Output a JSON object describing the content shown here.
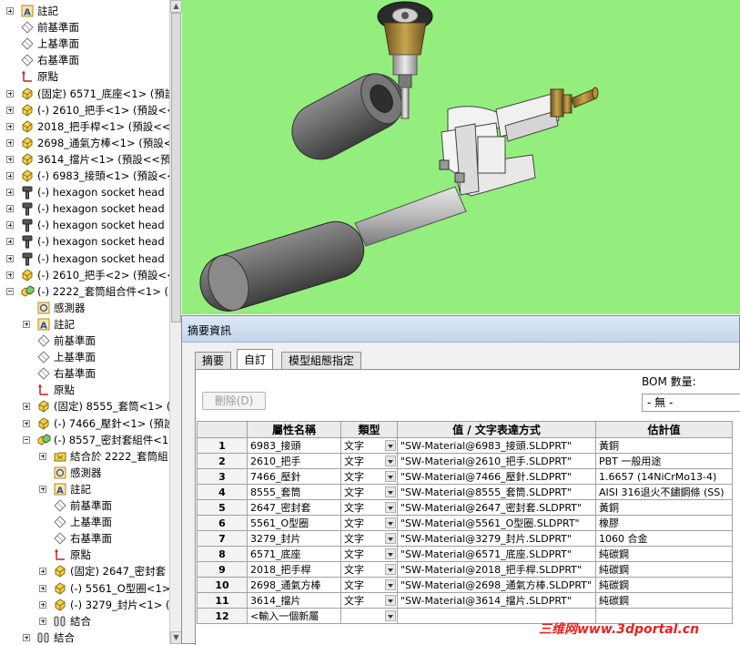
{
  "tree": {
    "nodes": [
      {
        "label": "註記",
        "icon": "annotation-icon",
        "level": 0,
        "exp": "plus"
      },
      {
        "label": "前基準面",
        "icon": "plane-icon",
        "level": 0,
        "exp": ""
      },
      {
        "label": "上基準面",
        "icon": "plane-icon",
        "level": 0,
        "exp": ""
      },
      {
        "label": "右基準面",
        "icon": "plane-icon",
        "level": 0,
        "exp": ""
      },
      {
        "label": "原點",
        "icon": "origin-icon",
        "level": 0,
        "exp": ""
      },
      {
        "label": "(固定) 6571_底座<1> (預設",
        "icon": "part-icon",
        "level": 0,
        "exp": "plus"
      },
      {
        "label": "(-) 2610_把手<1> (預設<<",
        "icon": "part-icon",
        "level": 0,
        "exp": "plus"
      },
      {
        "label": "2018_把手桿<1> (預設<<",
        "icon": "part-icon",
        "level": 0,
        "exp": "plus"
      },
      {
        "label": "2698_通氣方棒<1> (預設<",
        "icon": "part-icon",
        "level": 0,
        "exp": "plus"
      },
      {
        "label": "3614_擋片<1> (預設<<預",
        "icon": "part-icon",
        "level": 0,
        "exp": "plus"
      },
      {
        "label": "(-) 6983_接頭<1> (預設<<",
        "icon": "part-icon",
        "level": 0,
        "exp": "plus"
      },
      {
        "label": "(-) hexagon socket head",
        "icon": "screw-icon",
        "level": 0,
        "exp": "plus"
      },
      {
        "label": "(-) hexagon socket head",
        "icon": "screw-icon",
        "level": 0,
        "exp": "plus"
      },
      {
        "label": "(-) hexagon socket head",
        "icon": "screw-icon",
        "level": 0,
        "exp": "plus"
      },
      {
        "label": "(-) hexagon socket head",
        "icon": "screw-icon",
        "level": 0,
        "exp": "plus"
      },
      {
        "label": "(-) hexagon socket head",
        "icon": "screw-icon",
        "level": 0,
        "exp": "plus"
      },
      {
        "label": "(-) 2610_把手<2> (預設<<",
        "icon": "part-icon",
        "level": 0,
        "exp": "plus"
      },
      {
        "label": "(-) 2222_套筒組合件<1> (",
        "icon": "assembly-icon",
        "level": 0,
        "exp": "minus"
      },
      {
        "label": "感測器",
        "icon": "sensor-icon",
        "level": 1,
        "exp": ""
      },
      {
        "label": "註記",
        "icon": "annotation-icon",
        "level": 1,
        "exp": "plus"
      },
      {
        "label": "前基準面",
        "icon": "plane-icon",
        "level": 1,
        "exp": ""
      },
      {
        "label": "上基準面",
        "icon": "plane-icon",
        "level": 1,
        "exp": ""
      },
      {
        "label": "右基準面",
        "icon": "plane-icon",
        "level": 1,
        "exp": ""
      },
      {
        "label": "原點",
        "icon": "origin-icon",
        "level": 1,
        "exp": ""
      },
      {
        "label": "(固定) 8555_套筒<1> (",
        "icon": "part-icon",
        "level": 1,
        "exp": "plus"
      },
      {
        "label": "(-) 7466_壓針<1> (預設",
        "icon": "part-icon",
        "level": 1,
        "exp": "plus"
      },
      {
        "label": "(-) 8557_密封套組件<1",
        "icon": "assembly-icon",
        "level": 1,
        "exp": "minus"
      },
      {
        "label": "結合於 2222_套筒組",
        "icon": "mate-folder-icon",
        "level": 2,
        "exp": "plus"
      },
      {
        "label": "感測器",
        "icon": "sensor-icon",
        "level": 2,
        "exp": ""
      },
      {
        "label": "註記",
        "icon": "annotation-icon",
        "level": 2,
        "exp": "plus"
      },
      {
        "label": "前基準面",
        "icon": "plane-icon",
        "level": 2,
        "exp": ""
      },
      {
        "label": "上基準面",
        "icon": "plane-icon",
        "level": 2,
        "exp": ""
      },
      {
        "label": "右基準面",
        "icon": "plane-icon",
        "level": 2,
        "exp": ""
      },
      {
        "label": "原點",
        "icon": "origin-icon",
        "level": 2,
        "exp": ""
      },
      {
        "label": "(固定) 2647_密封套",
        "icon": "part-icon",
        "level": 2,
        "exp": "plus"
      },
      {
        "label": "(-) 5561_O型圈<1>",
        "icon": "part-icon",
        "level": 2,
        "exp": "plus"
      },
      {
        "label": "(-) 3279_封片<1> (",
        "icon": "part-icon",
        "level": 2,
        "exp": "plus"
      },
      {
        "label": "結合",
        "icon": "mates-icon",
        "level": 2,
        "exp": "plus"
      },
      {
        "label": "結合",
        "icon": "mates-icon",
        "level": 1,
        "exp": "plus"
      },
      {
        "label": "結合",
        "icon": "mates-icon",
        "level": 0,
        "exp": "plus"
      }
    ]
  },
  "dialog": {
    "title": "摘要資訊",
    "tabs": [
      {
        "label": "摘要",
        "active": false
      },
      {
        "label": "自訂",
        "active": true
      },
      {
        "label": "模型組態指定",
        "active": false
      }
    ],
    "delete_label": "刪除(D)",
    "bom_label": "BOM 數量:",
    "bom_value": "- 無 -",
    "headers": [
      "",
      "屬性名稱",
      "類型",
      "值 / 文字表達方式",
      "估計值"
    ],
    "rows": [
      {
        "n": "1",
        "name": "6983_接頭",
        "type": "文字",
        "expr": "\"SW-Material@6983_接頭.SLDPRT\"",
        "val": "黃銅"
      },
      {
        "n": "2",
        "name": "2610_把手",
        "type": "文字",
        "expr": "\"SW-Material@2610_把手.SLDPRT\"",
        "val": "PBT 一般用途"
      },
      {
        "n": "3",
        "name": "7466_壓針",
        "type": "文字",
        "expr": "\"SW-Material@7466_壓針.SLDPRT\"",
        "val": "1.6657 (14NiCrMo13-4)"
      },
      {
        "n": "4",
        "name": "8555_套筒",
        "type": "文字",
        "expr": "\"SW-Material@8555_套筒.SLDPRT\"",
        "val": "AISI 316退火不鏽鋼條 (SS)"
      },
      {
        "n": "5",
        "name": "2647_密封套",
        "type": "文字",
        "expr": "\"SW-Material@2647_密封套.SLDPRT\"",
        "val": "黃銅"
      },
      {
        "n": "6",
        "name": "5561_O型圈",
        "type": "文字",
        "expr": "\"SW-Material@5561_O型圈.SLDPRT\"",
        "val": "橡膠"
      },
      {
        "n": "7",
        "name": "3279_封片",
        "type": "文字",
        "expr": "\"SW-Material@3279_封片.SLDPRT\"",
        "val": "1060 合金"
      },
      {
        "n": "8",
        "name": "6571_底座",
        "type": "文字",
        "expr": "\"SW-Material@6571_底座.SLDPRT\"",
        "val": "純碳鋼"
      },
      {
        "n": "9",
        "name": "2018_把手桿",
        "type": "文字",
        "expr": "\"SW-Material@2018_把手桿.SLDPRT\"",
        "val": "純碳鋼"
      },
      {
        "n": "10",
        "name": "2698_通氣方棒",
        "type": "文字",
        "expr": "\"SW-Material@2698_通氣方棒.SLDPRT\"",
        "val": "純碳鋼"
      },
      {
        "n": "11",
        "name": "3614_擋片",
        "type": "文字",
        "expr": "\"SW-Material@3614_擋片.SLDPRT\"",
        "val": "純碳鋼"
      },
      {
        "n": "12",
        "name": "<輸入一個新屬",
        "type": "",
        "expr": "",
        "val": ""
      }
    ]
  },
  "watermark": "三维网www.3dportal.cn"
}
